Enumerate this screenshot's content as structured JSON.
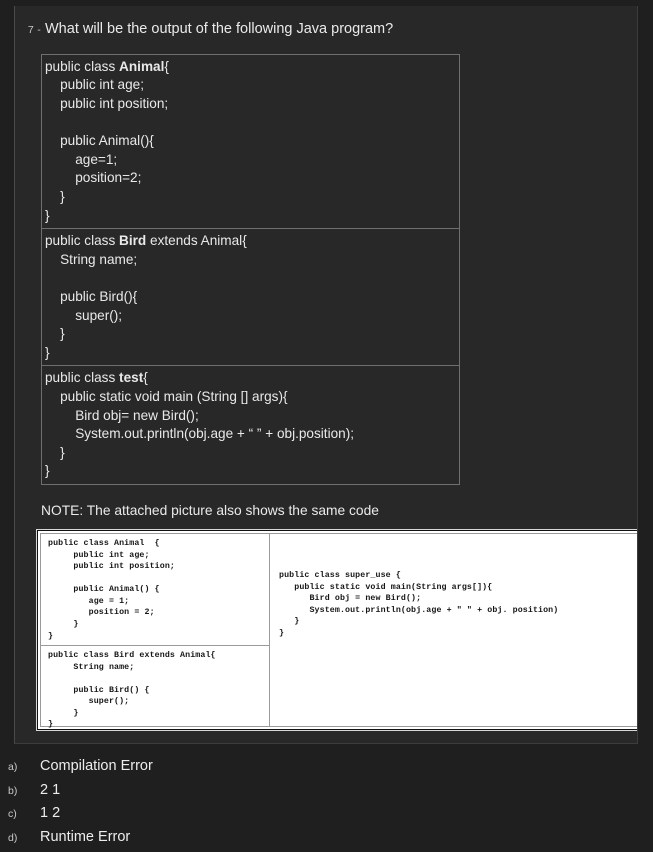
{
  "question": {
    "number": "7 -",
    "text": "What will be the output of the following Java program?"
  },
  "code_blocks": [
    {
      "name": "animal-class",
      "lines": [
        {
          "pre": "public class ",
          "bold": "Animal",
          "post": "{"
        },
        {
          "pre": "    public int age;",
          "bold": "",
          "post": ""
        },
        {
          "pre": "    public int position;",
          "bold": "",
          "post": ""
        },
        {
          "pre": " ",
          "bold": "",
          "post": ""
        },
        {
          "pre": "    public Animal(){",
          "bold": "",
          "post": ""
        },
        {
          "pre": "        age=1;",
          "bold": "",
          "post": ""
        },
        {
          "pre": "        position=2;",
          "bold": "",
          "post": ""
        },
        {
          "pre": "    }",
          "bold": "",
          "post": ""
        },
        {
          "pre": "}",
          "bold": "",
          "post": ""
        }
      ]
    },
    {
      "name": "bird-class",
      "lines": [
        {
          "pre": "public class ",
          "bold": "Bird",
          "post": " extends Animal{"
        },
        {
          "pre": "    String name;",
          "bold": "",
          "post": ""
        },
        {
          "pre": " ",
          "bold": "",
          "post": ""
        },
        {
          "pre": "    public Bird(){",
          "bold": "",
          "post": ""
        },
        {
          "pre": "        super();",
          "bold": "",
          "post": ""
        },
        {
          "pre": "    }",
          "bold": "",
          "post": ""
        },
        {
          "pre": "}",
          "bold": "",
          "post": ""
        }
      ]
    },
    {
      "name": "test-class",
      "lines": [
        {
          "pre": "public class ",
          "bold": "test",
          "post": "{"
        },
        {
          "pre": "    public static void main (String [] args){",
          "bold": "",
          "post": ""
        },
        {
          "pre": "        Bird obj= new Bird();",
          "bold": "",
          "post": ""
        },
        {
          "pre": "        System.out.println(obj.age + “ ” + obj.position);",
          "bold": "",
          "post": ""
        },
        {
          "pre": "    }",
          "bold": "",
          "post": ""
        },
        {
          "pre": "}",
          "bold": "",
          "post": ""
        }
      ]
    }
  ],
  "note": "NOTE: The attached picture also shows the same code",
  "attached_picture": {
    "left_top_lines": [
      "public class Animal  {",
      "     public int age;",
      "     public int position;",
      " ",
      "     public Animal() {",
      "        age = 1;",
      "        position = 2;",
      "     }",
      "}"
    ],
    "left_bottom_lines": [
      "public class Bird extends Animal{",
      "     String name;",
      " ",
      "     public Bird() {",
      "        super();",
      "     }",
      "}"
    ],
    "right_lines": [
      "public class super_use {",
      "   public static void main(String args[]){",
      "      Bird obj = new Bird();",
      "      System.out.println(obj.age + \" \" + obj. position)",
      "   }",
      "}"
    ]
  },
  "options": [
    {
      "letter": "a)",
      "text": "Compilation Error"
    },
    {
      "letter": "b)",
      "text": "2 1"
    },
    {
      "letter": "c)",
      "text": "1 2"
    },
    {
      "letter": "d)",
      "text": "Runtime Error"
    }
  ],
  "colors": {
    "page_background": "#1f1f1f",
    "card_background": "#282828",
    "code_border": "#6f6f6f",
    "text": "#e9e9e9",
    "muted_text": "#c9c9c9",
    "picture_background": "#ffffff"
  }
}
